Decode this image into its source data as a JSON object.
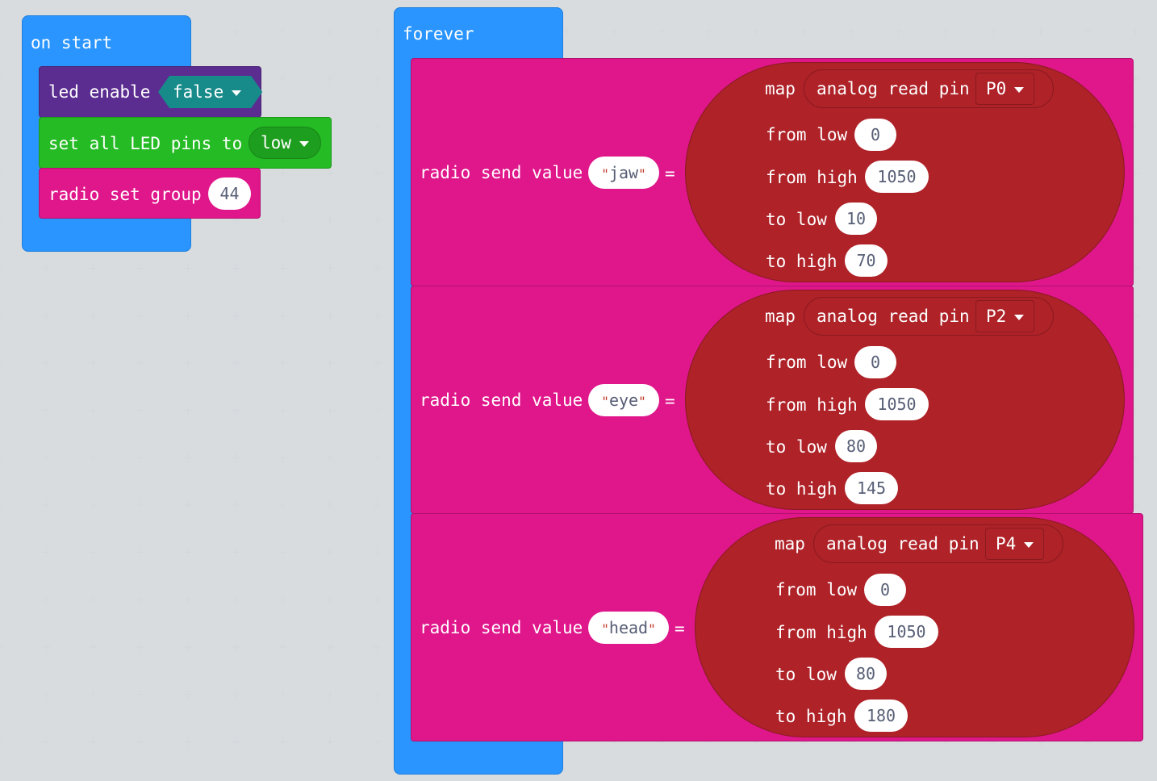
{
  "workspace": {
    "on_start": {
      "label": "on start",
      "blocks": {
        "led_enable": {
          "label": "led enable",
          "value": "false"
        },
        "set_led_pins": {
          "label": "set all LED pins to",
          "value": "low"
        },
        "radio_set_group": {
          "label": "radio set group",
          "value": "44"
        }
      }
    },
    "forever": {
      "label": "forever",
      "sends": [
        {
          "label": "radio send value",
          "name": "jaw",
          "equals": "=",
          "map": {
            "label": "map",
            "read_label": "analog read pin",
            "pin": "P0",
            "from_low_label": "from low",
            "from_low": "0",
            "from_high_label": "from high",
            "from_high": "1050",
            "to_low_label": "to low",
            "to_low": "10",
            "to_high_label": "to high",
            "to_high": "70"
          }
        },
        {
          "label": "radio send value",
          "name": "eye",
          "equals": "=",
          "map": {
            "label": "map",
            "read_label": "analog read pin",
            "pin": "P2",
            "from_low_label": "from low",
            "from_low": "0",
            "from_high_label": "from high",
            "from_high": "1050",
            "to_low_label": "to low",
            "to_low": "80",
            "to_high_label": "to high",
            "to_high": "145"
          }
        },
        {
          "label": "radio send value",
          "name": "head",
          "equals": "=",
          "map": {
            "label": "map",
            "read_label": "analog read pin",
            "pin": "P4",
            "from_low_label": "from low",
            "from_low": "0",
            "from_high_label": "from high",
            "from_high": "1050",
            "to_low_label": "to low",
            "to_low": "80",
            "to_high_label": "to high",
            "to_high": "180"
          }
        }
      ]
    },
    "colors": {
      "background": "#ecf0f1",
      "basic": "#2a95ff",
      "led": "#5c2d91",
      "pins": "#24bb24",
      "radio": "#e0168b",
      "math": "#ae2228",
      "logic": "#178a8a"
    }
  }
}
